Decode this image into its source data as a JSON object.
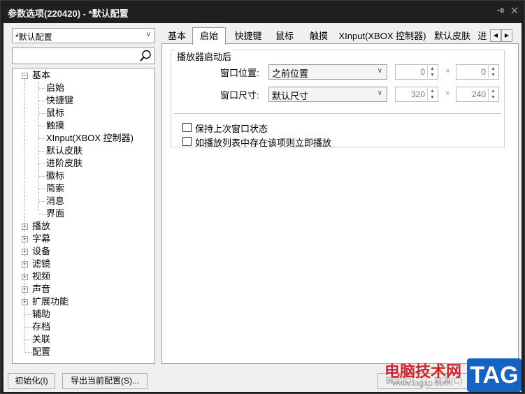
{
  "window": {
    "title": "参数选项(220420) - *默认配置",
    "pin_icon": "pin-icon",
    "close_icon": "close-icon"
  },
  "sidebar": {
    "profile": "*默认配置",
    "search": {
      "value": "",
      "placeholder": ""
    },
    "tree": [
      {
        "label": "基本",
        "expander": "⊟",
        "children": [
          "启始",
          "快捷键",
          "鼠标",
          "触摸",
          "XInput(XBOX 控制器)",
          "默认皮肤",
          "进阶皮肤",
          "徽标",
          "简索",
          "消息",
          "界面"
        ]
      },
      {
        "label": "播放",
        "expander": "⊞"
      },
      {
        "label": "字幕",
        "expander": "⊞"
      },
      {
        "label": "设备",
        "expander": "⊞"
      },
      {
        "label": "滤镜",
        "expander": "⊞"
      },
      {
        "label": "视频",
        "expander": "⊞"
      },
      {
        "label": "声音",
        "expander": "⊞"
      },
      {
        "label": "扩展功能",
        "expander": "⊞"
      },
      {
        "label": "辅助"
      },
      {
        "label": "存档"
      },
      {
        "label": "关联"
      },
      {
        "label": "配置"
      }
    ]
  },
  "tabs": {
    "items": [
      "基本",
      "启始",
      "快捷键",
      "鼠标",
      "触摸",
      "XInput(XBOX 控制器)",
      "默认皮肤",
      "进"
    ],
    "active": "启始",
    "scroll_left": "◀",
    "scroll_right": "▶"
  },
  "page": {
    "group_title": "播放器启动后",
    "position_label": "窗口位置:",
    "position_value": "之前位置",
    "position_x": "0",
    "position_y": "0",
    "size_label": "窗口尺寸:",
    "size_value": "默认尺寸",
    "size_w": "320",
    "size_h": "240",
    "times": "×",
    "check_keep_state": "保持上次窗口状态",
    "check_play_if_exists": "如播放列表中存在该项则立即播放"
  },
  "footer": {
    "reset": "初始化(I)",
    "export": "导出当前配置(S)...",
    "ok": "确定(O)",
    "cancel": "取消(C)"
  },
  "watermark": {
    "text": "电脑技术网",
    "url": "www.tagxp.com",
    "logo": "TAG"
  }
}
